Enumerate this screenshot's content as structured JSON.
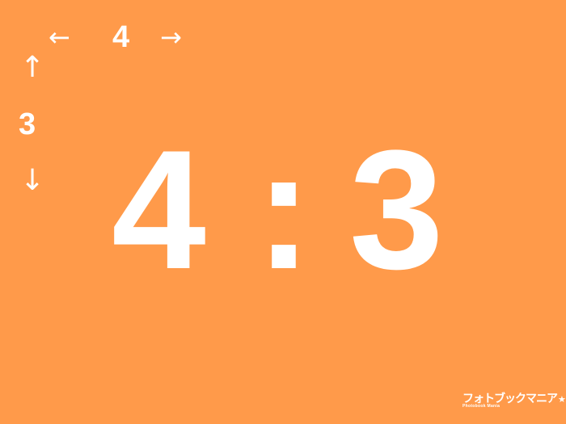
{
  "colors": {
    "background": "#FF9A4A",
    "foreground": "#FFFFFF"
  },
  "width_indicator": {
    "left_arrow": "←",
    "label": "4",
    "right_arrow": "→"
  },
  "height_indicator": {
    "up_arrow": "↑",
    "label": "3",
    "down_arrow": "↓"
  },
  "ratio": {
    "left": "4",
    "separator": ":",
    "right": "3"
  },
  "logo": {
    "main": "フォトブックマニア",
    "star": "★",
    "sub": "Photobook Mania",
    "icon": "star-icon"
  }
}
